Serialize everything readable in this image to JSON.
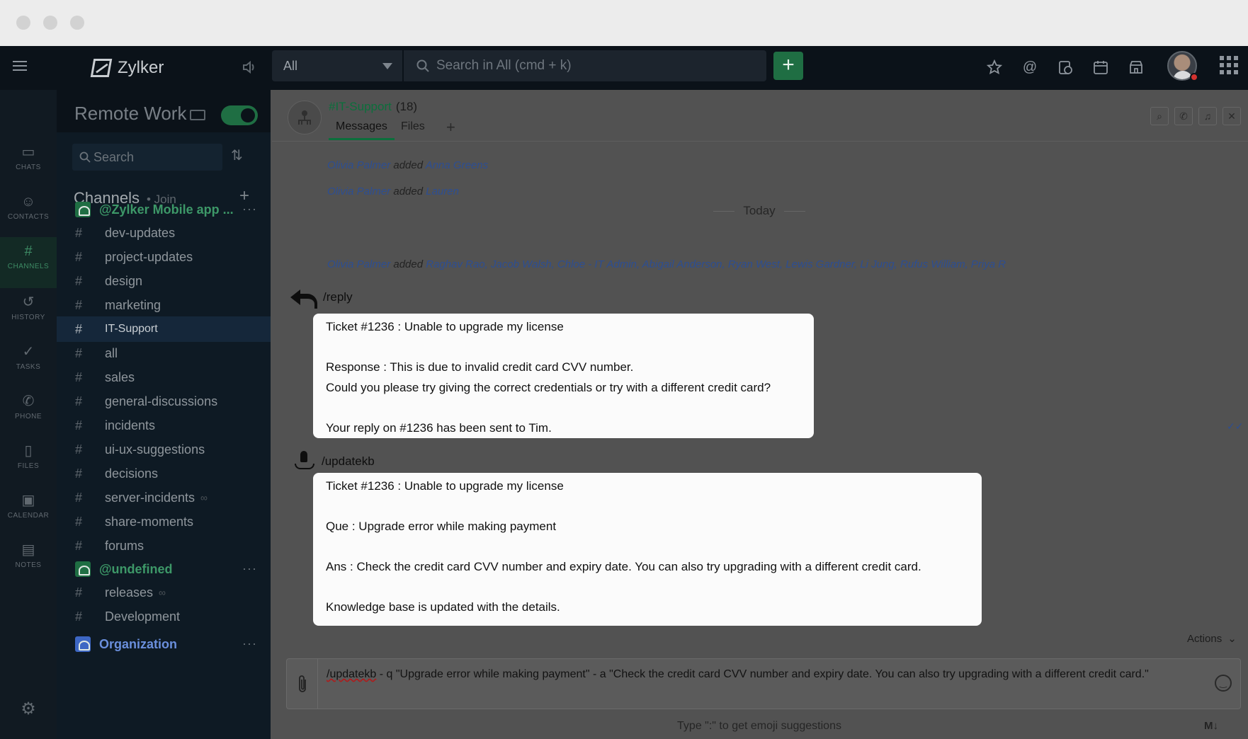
{
  "topbar": {
    "brand": "Zylker",
    "scope": "All",
    "search_placeholder": "Search in All (cmd + k)",
    "new_button": "+"
  },
  "rail": {
    "items": [
      {
        "label": "CHATS",
        "icon": "chat-icon"
      },
      {
        "label": "CONTACTS",
        "icon": "person-icon"
      },
      {
        "label": "CHANNELS",
        "icon": "hash-icon"
      },
      {
        "label": "HISTORY",
        "icon": "history-icon"
      },
      {
        "label": "TASKS",
        "icon": "check-icon"
      },
      {
        "label": "PHONE",
        "icon": "phone-icon"
      },
      {
        "label": "FILES",
        "icon": "file-icon"
      },
      {
        "label": "CALENDAR",
        "icon": "calendar-icon"
      },
      {
        "label": "NOTES",
        "icon": "notes-icon"
      }
    ],
    "active": "CHANNELS"
  },
  "sidebar": {
    "workspace": "Remote Work",
    "search_placeholder": "Search",
    "channels_title": "Channels",
    "join": "• Join",
    "groups": {
      "g1": "@Zylker Mobile app ...",
      "g2": "@undefined",
      "g3": "Organization"
    },
    "channels": [
      "dev-updates",
      "project-updates",
      "design",
      "marketing",
      "IT-Support",
      "all",
      "sales",
      "general-discussions",
      "incidents",
      "ui-ux-suggestions",
      "decisions",
      "server-incidents",
      "share-moments",
      "forums"
    ],
    "channels_b": [
      "releases",
      "Development"
    ],
    "selected": "IT-Support"
  },
  "conversation": {
    "title": "#IT-Support",
    "count": "(18)",
    "tabs": [
      "Messages",
      "Files"
    ],
    "active_tab": "Messages",
    "events": [
      {
        "actor": "Olivia Palmer",
        "verb": "added",
        "target": "Anna Greens"
      },
      {
        "actor": "Olivia Palmer",
        "verb": "added",
        "target": "Lauren"
      }
    ],
    "day_divider": "Today",
    "event_today": {
      "actor": "Olivia Palmer",
      "verb": "added",
      "target": "Raghav Rao, Jacob Walsh, Chloe - IT Admin, Abigail Anderson, Ryan West, Lewis Gardner, Li Jung, Rufus William, Priya R"
    },
    "messages": [
      {
        "command": "/reply",
        "lines": {
          "l1": "Ticket #1236 : Unable to upgrade my license",
          "l2": "Response : This is due to invalid credit card CVV number.",
          "l3": "Could you please try giving the correct credentials or try with a different credit card?",
          "l4": "Your reply on #1236 has been sent to Tim."
        }
      },
      {
        "command": "/updatekb",
        "lines": {
          "l1": "Ticket #1236 : Unable to upgrade my license",
          "l2": "Que : Upgrade error while making payment",
          "l3": "Ans : Check the credit card CVV number and expiry date. You can also try upgrading with a different credit card.",
          "l4": "Knowledge base is updated with the details."
        }
      }
    ]
  },
  "composer": {
    "actions": "Actions",
    "command_word": "/updatekb",
    "rest": " - q \"Upgrade error while making payment\" - a \"Check the credit card CVV number and expiry date. You can also try upgrading with a different credit card.\"",
    "hint": "Type \":\" to get emoji suggestions",
    "markdown": "M↓"
  },
  "colors": {
    "accent": "#1f6e43",
    "link": "#2d4e92",
    "rail_bg": "#111a22",
    "sidebar_bg": "#0e1a24"
  }
}
